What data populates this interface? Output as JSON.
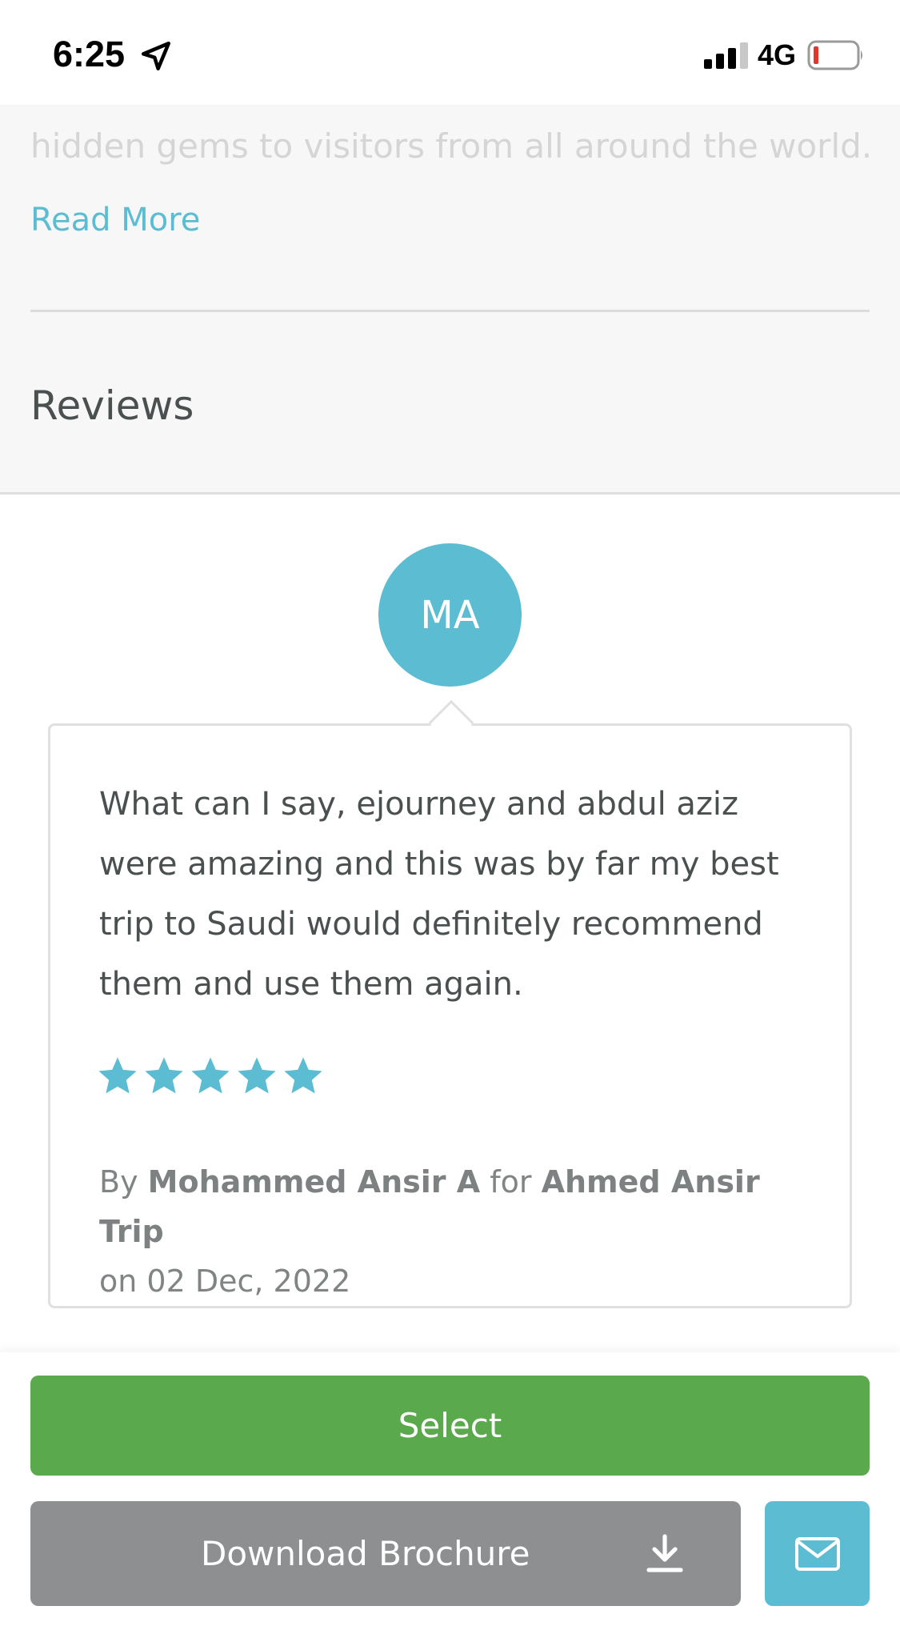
{
  "status_bar": {
    "time": "6:25",
    "network": "4G",
    "icons": [
      "location-arrow-icon",
      "signal-icon",
      "battery-low-icon"
    ]
  },
  "description": {
    "visible_text": "hidden gems to visitors from all around the world.",
    "read_more_label": "Read More"
  },
  "reviews": {
    "title": "Reviews",
    "items": [
      {
        "initials": "MA",
        "text": "What can I say, ejourney and abdul aziz were amazing and this was by far my best trip to Saudi would definitely recommend them and use them again.",
        "rating": 5,
        "by_label": "By",
        "author": "Mohammed Ansir A",
        "for_label": "for",
        "trip": "Ahmed Ansir Trip",
        "date": "on 02 Dec, 2022"
      }
    ]
  },
  "actions": {
    "select_label": "Select",
    "brochure_label": "Download Brochure",
    "brochure_icon": "download-icon",
    "mail_icon": "mail-icon"
  },
  "colors": {
    "accent": "#5bbcd2",
    "select_green": "#5aaa4d",
    "brochure_gray": "#8d8f90",
    "battery_red": "#e8332a"
  }
}
